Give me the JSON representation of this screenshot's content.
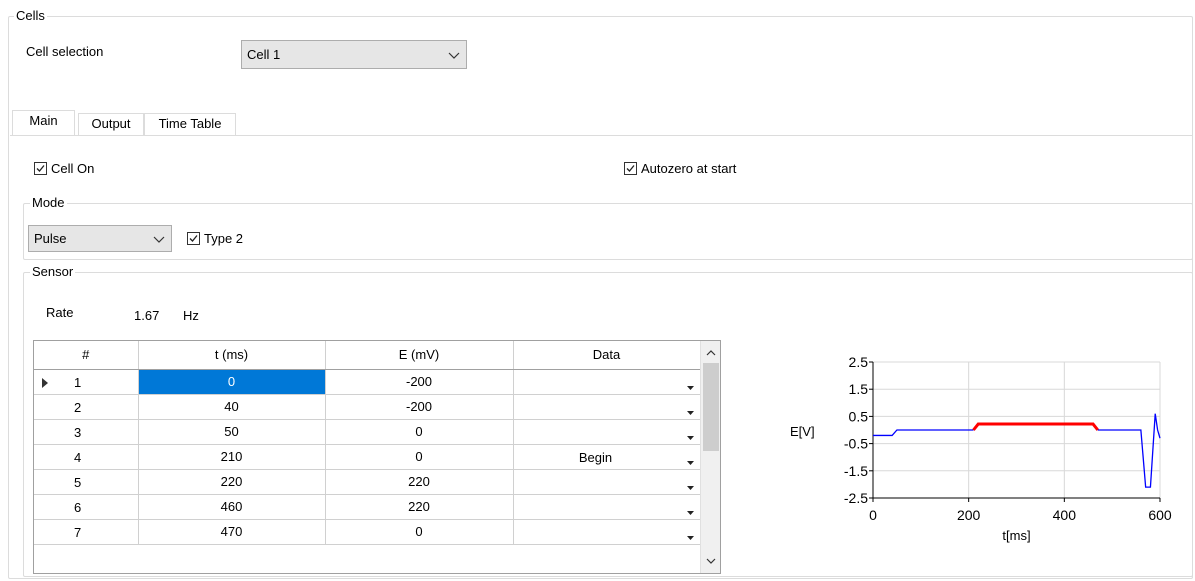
{
  "cells_group": {
    "title": "Cells",
    "cell_selection_label": "Cell selection",
    "cell_selection_value": "Cell 1"
  },
  "tabs": [
    {
      "label": "Main",
      "active": true
    },
    {
      "label": "Output",
      "active": false
    },
    {
      "label": "Time Table",
      "active": false
    }
  ],
  "main": {
    "cell_on_label": "Cell On",
    "cell_on_checked": true,
    "autozero_label": "Autozero at start",
    "autozero_checked": true,
    "mode_group_title": "Mode",
    "mode_value": "Pulse",
    "type2_label": "Type 2",
    "type2_checked": true,
    "sensor_group_title": "Sensor",
    "rate_label": "Rate",
    "rate_value": "1.67",
    "rate_unit": "Hz"
  },
  "grid": {
    "columns": [
      "#",
      "t (ms)",
      "E (mV)",
      "Data"
    ],
    "rows": [
      {
        "num": "1",
        "t": "0",
        "e": "-200",
        "data": "",
        "current": true
      },
      {
        "num": "2",
        "t": "40",
        "e": "-200",
        "data": ""
      },
      {
        "num": "3",
        "t": "50",
        "e": "0",
        "data": ""
      },
      {
        "num": "4",
        "t": "210",
        "e": "0",
        "data": "Begin"
      },
      {
        "num": "5",
        "t": "220",
        "e": "220",
        "data": ""
      },
      {
        "num": "6",
        "t": "460",
        "e": "220",
        "data": ""
      },
      {
        "num": "7",
        "t": "470",
        "e": "0",
        "data": ""
      }
    ]
  },
  "chart_data": {
    "type": "line",
    "xlabel": "t[ms]",
    "ylabel": "E[V]",
    "xlim": [
      0,
      600
    ],
    "ylim": [
      -2.5,
      2.5
    ],
    "x_ticks": [
      "0",
      "200",
      "400",
      "600"
    ],
    "y_ticks": [
      "2.5",
      "1.5",
      "0.5",
      "-0.5",
      "-1.5",
      "-2.5"
    ],
    "grid": true,
    "series": [
      {
        "color": "#0000ff",
        "x": [
          0,
          40,
          50,
          210
        ],
        "y": [
          -0.2,
          -0.2,
          0.0,
          0.0
        ]
      },
      {
        "color": "#ff0000",
        "x": [
          210,
          220,
          460,
          470
        ],
        "y": [
          0.0,
          0.22,
          0.22,
          0.0
        ]
      },
      {
        "color": "#0000ff",
        "x": [
          470,
          560,
          570,
          580,
          590,
          595,
          600
        ],
        "y": [
          0.0,
          0.0,
          -2.1,
          -2.1,
          0.6,
          0.0,
          -0.3
        ]
      }
    ]
  }
}
